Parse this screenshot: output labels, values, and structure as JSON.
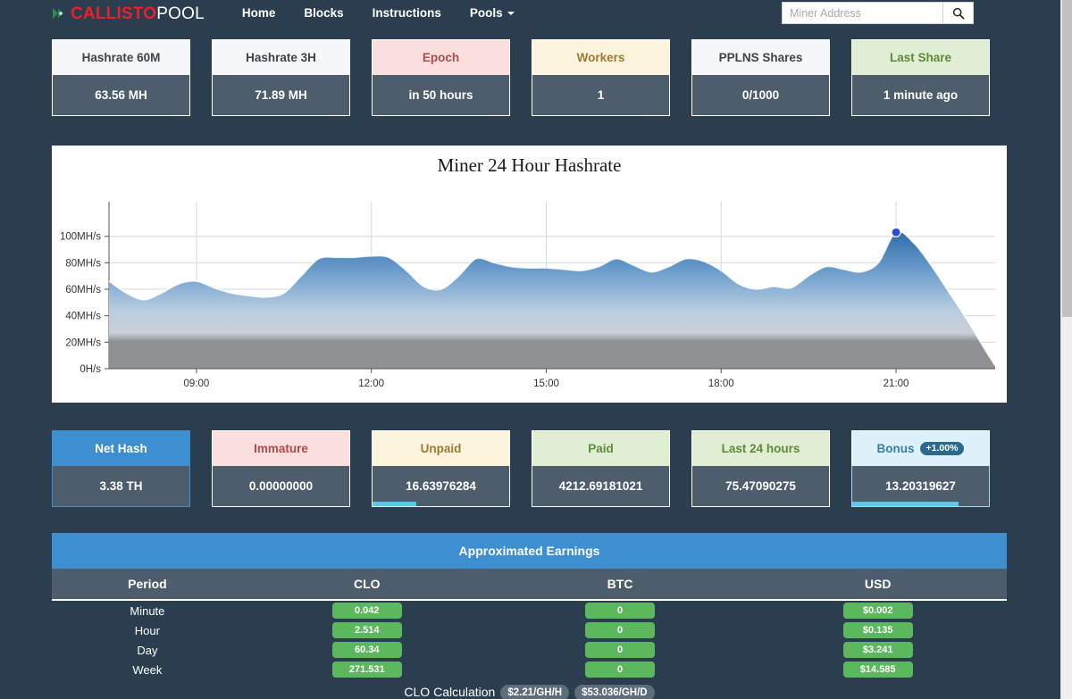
{
  "navbar": {
    "brand": {
      "icon": "callisto-logo-icon",
      "name_primary": "CALLISTO",
      "name_secondary": "POOL"
    },
    "links": [
      {
        "label": "Home"
      },
      {
        "label": "Blocks"
      },
      {
        "label": "Instructions"
      },
      {
        "label": "Pools",
        "has_caret": true
      }
    ],
    "search": {
      "placeholder": "Miner Address",
      "value": "",
      "icon": "search-icon"
    }
  },
  "stats_top": [
    {
      "title": "Hashrate 60M",
      "value": "63.56 MH",
      "style": "default"
    },
    {
      "title": "Hashrate 3H",
      "value": "71.89 MH",
      "style": "default"
    },
    {
      "title": "Epoch",
      "value": "in 50 hours",
      "style": "danger"
    },
    {
      "title": "Workers",
      "value": "1",
      "style": "warning"
    },
    {
      "title": "PPLNS Shares",
      "value": "0/1000",
      "style": "default"
    },
    {
      "title": "Last Share",
      "value": "1 minute ago",
      "style": "success"
    }
  ],
  "stats_bottom": [
    {
      "title": "Net Hash",
      "value": "3.38 TH",
      "style": "primary",
      "progress": 0
    },
    {
      "title": "Immature",
      "value": "0.00000000",
      "style": "danger",
      "progress": 0
    },
    {
      "title": "Unpaid",
      "value": "16.63976284",
      "style": "warning",
      "progress": 32
    },
    {
      "title": "Paid",
      "value": "4212.69181021",
      "style": "success",
      "progress": 0
    },
    {
      "title": "Last 24 hours",
      "value": "75.47090275",
      "style": "success",
      "progress": 0
    },
    {
      "title": "Bonus",
      "value": "13.20319627",
      "style": "info",
      "progress": 78,
      "badge": "+1.00%"
    }
  ],
  "earnings": {
    "title": "Approximated Earnings",
    "columns": [
      "Period",
      "CLO",
      "BTC",
      "USD"
    ],
    "rows": [
      {
        "period": "Minute",
        "clo": "0.042",
        "btc": "0",
        "usd": "$0.002"
      },
      {
        "period": "Hour",
        "clo": "2.514",
        "btc": "0",
        "usd": "$0.135"
      },
      {
        "period": "Day",
        "clo": "60.34",
        "btc": "0",
        "usd": "$3.241"
      },
      {
        "period": "Week",
        "clo": "271.531",
        "btc": "0",
        "usd": "$14.585"
      }
    ],
    "calculation_label": "CLO Calculation",
    "calculation_badges": [
      "$2.21/GH/H",
      "$53.036/GH/D"
    ]
  },
  "chart_data": {
    "type": "area",
    "title": "Miner 24 Hour Hashrate",
    "xlabel": "",
    "ylabel": "",
    "grid": true,
    "legend": false,
    "ytick_labels": [
      "0H/s",
      "20MH/s",
      "40MH/s",
      "60MH/s",
      "80MH/s",
      "100MH/s"
    ],
    "ytick_values": [
      0,
      20,
      40,
      60,
      80,
      100
    ],
    "ylim": [
      0,
      118
    ],
    "xtick_labels": [
      "09:00",
      "12:00",
      "15:00",
      "18:00",
      "21:00"
    ],
    "xtick_values": [
      9,
      12,
      15,
      18,
      21
    ],
    "xlim": [
      7.5,
      22.7
    ],
    "unit": "MH/s",
    "highlight_point": {
      "x": 21.0,
      "y": 103
    },
    "x": [
      7.5,
      7.8,
      8.1,
      8.4,
      8.7,
      9.0,
      9.3,
      9.6,
      9.9,
      10.2,
      10.5,
      10.8,
      11.1,
      11.4,
      11.7,
      12.0,
      12.3,
      12.6,
      12.9,
      13.2,
      13.5,
      13.8,
      14.1,
      14.4,
      14.7,
      15.0,
      15.3,
      15.6,
      15.9,
      16.2,
      16.5,
      16.8,
      17.1,
      17.4,
      17.7,
      18.0,
      18.3,
      18.6,
      18.9,
      19.2,
      19.5,
      19.8,
      20.1,
      20.4,
      20.7,
      21.0,
      21.3,
      21.6,
      21.9,
      22.2,
      22.5,
      22.7
    ],
    "values": [
      66,
      57,
      52,
      57,
      64,
      66,
      61,
      57,
      55,
      54,
      57,
      70,
      83,
      84,
      84,
      85,
      84,
      74,
      62,
      60,
      70,
      83,
      80,
      77,
      76,
      76,
      75,
      74,
      77,
      83,
      78,
      73,
      77,
      83,
      81,
      74,
      64,
      60,
      62,
      61,
      70,
      77,
      75,
      73,
      80,
      103,
      95,
      78,
      58,
      38,
      16,
      2
    ]
  }
}
